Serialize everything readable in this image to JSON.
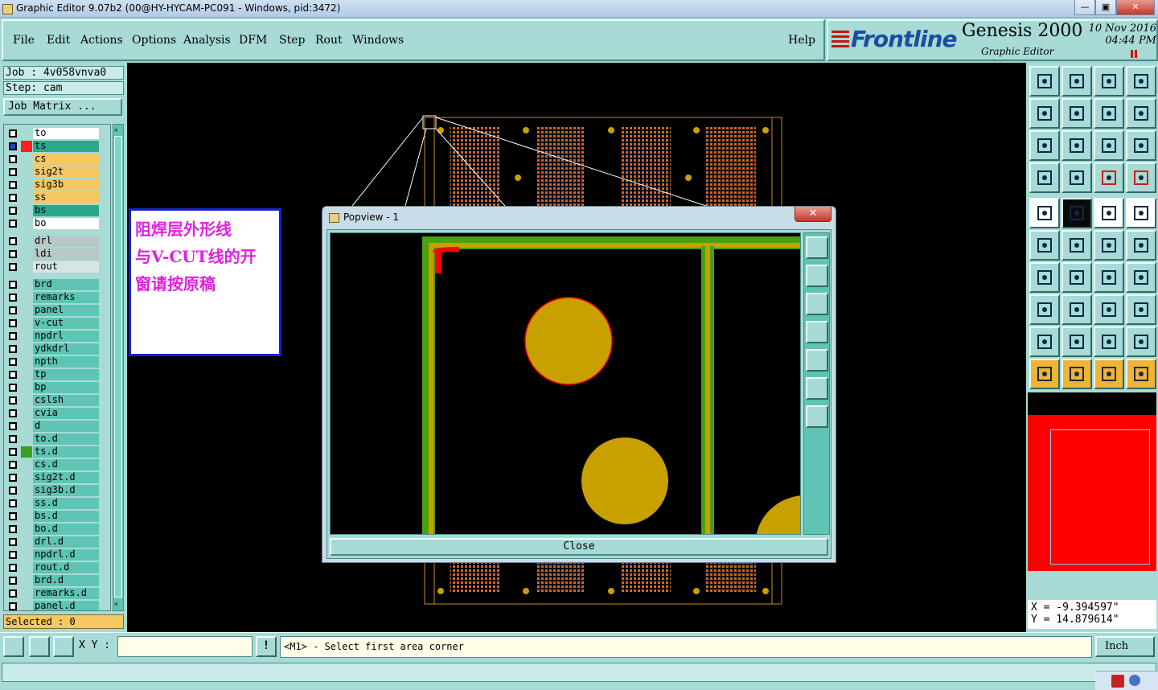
{
  "window": {
    "title": "Graphic Editor 9.07b2 (00@HY-HYCAM-PC091 - Windows, pid:3472)",
    "controls": [
      "—",
      "▣",
      "✕"
    ]
  },
  "menu": [
    "File",
    "Edit",
    "Actions",
    "Options",
    "Analysis",
    "DFM",
    "Step",
    "Rout",
    "Windows"
  ],
  "help": "Help",
  "brand": {
    "logo": "Frontline",
    "product": "Genesis 2000",
    "subtitle": "Graphic Editor",
    "date": "10 Nov 2016",
    "time": "04:44 PM"
  },
  "job": {
    "job_label": "Job : 4v058vnva0",
    "step_label": "Step: cam",
    "matrix_button": "Job Matrix ..."
  },
  "layers": [
    {
      "name": "to",
      "color": "#ffffff",
      "swatch": "",
      "checked": false
    },
    {
      "name": "ts",
      "color": "#2aa88a",
      "swatch": "#ff2020",
      "checked": true
    },
    {
      "name": "cs",
      "color": "#f6c862",
      "swatch": "",
      "checked": false
    },
    {
      "name": "sig2t",
      "color": "#f6c862",
      "swatch": "",
      "checked": false
    },
    {
      "name": "sig3b",
      "color": "#f6c862",
      "swatch": "",
      "checked": false
    },
    {
      "name": "ss",
      "color": "#f6c862",
      "swatch": "",
      "checked": false
    },
    {
      "name": "bs",
      "color": "#2aa88a",
      "swatch": "",
      "checked": false
    },
    {
      "name": "bo",
      "color": "#ffffff",
      "swatch": "",
      "checked": false
    },
    {
      "name": "drl",
      "color": "#b8c8c8",
      "swatch": "",
      "checked": false
    },
    {
      "name": "ldi",
      "color": "#b8c8c8",
      "swatch": "",
      "checked": false
    },
    {
      "name": "rout",
      "color": "#d8e4e4",
      "swatch": "",
      "checked": false
    },
    {
      "name": "brd",
      "color": "#5ec4b4",
      "swatch": "",
      "checked": false
    },
    {
      "name": "remarks",
      "color": "#5ec4b4",
      "swatch": "",
      "checked": false
    },
    {
      "name": "panel",
      "color": "#5ec4b4",
      "swatch": "",
      "checked": false
    },
    {
      "name": "v-cut",
      "color": "#5ec4b4",
      "swatch": "",
      "checked": false
    },
    {
      "name": "npdrl",
      "color": "#5ec4b4",
      "swatch": "",
      "checked": false
    },
    {
      "name": "ydkdrl",
      "color": "#5ec4b4",
      "swatch": "",
      "checked": false
    },
    {
      "name": "npth",
      "color": "#5ec4b4",
      "swatch": "",
      "checked": false
    },
    {
      "name": "tp",
      "color": "#5ec4b4",
      "swatch": "",
      "checked": false
    },
    {
      "name": "bp",
      "color": "#5ec4b4",
      "swatch": "",
      "checked": false
    },
    {
      "name": "cslsh",
      "color": "#5ec4b4",
      "swatch": "",
      "checked": false
    },
    {
      "name": "cvia",
      "color": "#5ec4b4",
      "swatch": "",
      "checked": false
    },
    {
      "name": "d",
      "color": "#5ec4b4",
      "swatch": "",
      "checked": false
    },
    {
      "name": "to.d",
      "color": "#5ec4b4",
      "swatch": "",
      "checked": false
    },
    {
      "name": "ts.d",
      "color": "#5ec4b4",
      "swatch": "#3aa020",
      "checked": false
    },
    {
      "name": "cs.d",
      "color": "#5ec4b4",
      "swatch": "",
      "checked": false
    },
    {
      "name": "sig2t.d",
      "color": "#5ec4b4",
      "swatch": "",
      "checked": false
    },
    {
      "name": "sig3b.d",
      "color": "#5ec4b4",
      "swatch": "",
      "checked": false
    },
    {
      "name": "ss.d",
      "color": "#5ec4b4",
      "swatch": "",
      "checked": false
    },
    {
      "name": "bs.d",
      "color": "#5ec4b4",
      "swatch": "",
      "checked": false
    },
    {
      "name": "bo.d",
      "color": "#5ec4b4",
      "swatch": "",
      "checked": false
    },
    {
      "name": "drl.d",
      "color": "#5ec4b4",
      "swatch": "",
      "checked": false
    },
    {
      "name": "npdrl.d",
      "color": "#5ec4b4",
      "swatch": "",
      "checked": false
    },
    {
      "name": "rout.d",
      "color": "#5ec4b4",
      "swatch": "",
      "checked": false
    },
    {
      "name": "brd.d",
      "color": "#5ec4b4",
      "swatch": "",
      "checked": false
    },
    {
      "name": "remarks.d",
      "color": "#5ec4b4",
      "swatch": "",
      "checked": false
    },
    {
      "name": "panel.d",
      "color": "#5ec4b4",
      "swatch": "",
      "checked": false
    }
  ],
  "selected": "Selected : 0",
  "note_lines": [
    "阻焊层外形线",
    "与V-CUT线的开",
    "窗请按原稿"
  ],
  "popup": {
    "title": "Popview - 1",
    "close_x": "✕",
    "close_label": "Close"
  },
  "coords": {
    "x": "X = -9.394597\"",
    "y": "Y = 14.879614\""
  },
  "bottom": {
    "xy_label": "X Y :",
    "xy_value": "",
    "prompt_icon": "!",
    "prompt": "<M1> - Select first area corner",
    "unit": "Inch"
  },
  "colors": {
    "panel": "#a8dad6",
    "copper": "#c8a000",
    "soldermask": "#4aa010",
    "accent_red": "#ff0000"
  }
}
